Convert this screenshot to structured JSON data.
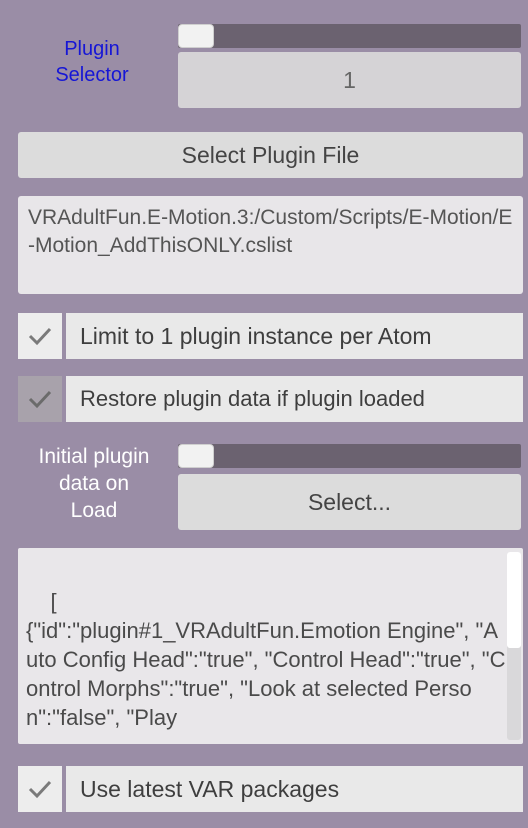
{
  "plugin_selector": {
    "label_line1": "Plugin",
    "label_line2": "Selector",
    "value": "1",
    "slider_fraction": 0.0
  },
  "select_file_button": "Select Plugin File",
  "plugin_path": "VRAdultFun.E-Motion.3:/Custom/Scripts/E-Motion/E-Motion_AddThisONLY.cslist",
  "limit_toggle": {
    "checked": true,
    "label": "Limit to 1 plugin instance per Atom"
  },
  "restore_toggle": {
    "checked": true,
    "label": "Restore plugin data if plugin loaded"
  },
  "initial_data": {
    "label_line1": "Initial plugin",
    "label_line2": "data on",
    "label_line3": "Load",
    "button": "Select...",
    "slider_fraction": 0.0
  },
  "json_preview": "[\n{\"id\":\"plugin#1_VRAdultFun.Emotion Engine\", \"Auto Config Head\":\"true\", \"Control Head\":\"true\", \"Control Morphs\":\"true\", \"Look at selected Person\":\"false\", \"Play",
  "var_toggle": {
    "checked": true,
    "label": "Use latest VAR packages"
  }
}
